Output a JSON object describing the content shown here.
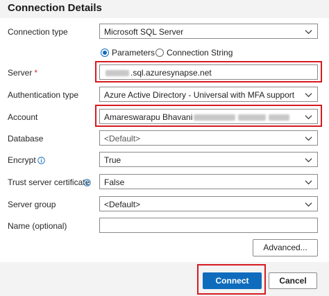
{
  "header": {
    "title": "Connection Details"
  },
  "form": {
    "connection_type": {
      "label": "Connection type",
      "value": "Microsoft SQL Server"
    },
    "input_mode": {
      "options": [
        "Parameters",
        "Connection String"
      ],
      "selected": "Parameters"
    },
    "server": {
      "label": "Server",
      "required_marker": "*",
      "value_suffix": ".sql.azuresynapse.net"
    },
    "authentication_type": {
      "label": "Authentication type",
      "value": "Azure Active Directory - Universal with MFA support"
    },
    "account": {
      "label": "Account",
      "value": "Amareswarapu Bhavani"
    },
    "database": {
      "label": "Database",
      "value": "<Default>"
    },
    "encrypt": {
      "label": "Encrypt",
      "value": "True"
    },
    "trust_server_certificate": {
      "label": "Trust server certificate",
      "value": "False"
    },
    "server_group": {
      "label": "Server group",
      "value": "<Default>"
    },
    "name": {
      "label": "Name (optional)",
      "value": ""
    }
  },
  "buttons": {
    "advanced": "Advanced...",
    "connect": "Connect",
    "cancel": "Cancel"
  },
  "icons": {
    "dropdown": "chevron-down-icon",
    "info": "info-icon"
  },
  "colors": {
    "accent": "#0f6cbd",
    "highlight": "#d7191f",
    "required": "#d13438"
  }
}
